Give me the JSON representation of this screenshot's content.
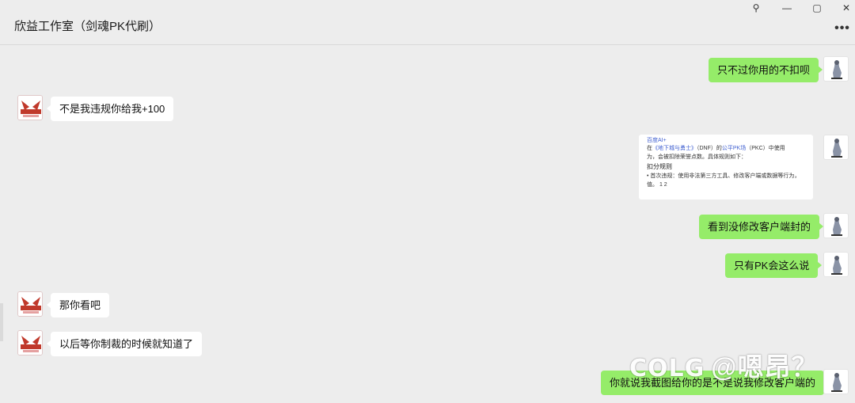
{
  "window": {
    "title": "欣益工作室（剑魂PK代刷）",
    "controls": {
      "pin": "⚲",
      "minimize": "—",
      "maximize": "▢",
      "close": "✕"
    },
    "more": "•••"
  },
  "messages": [
    {
      "side": "right",
      "text": "只不过你用的不扣呗"
    },
    {
      "side": "left",
      "text": "不是我违规你给我+100"
    },
    {
      "side": "right",
      "type": "image",
      "image": {
        "header": "百度AI+",
        "line1_prefix": "在",
        "line1_link1": "《地下城与勇士》",
        "line1_mid": "（DNF）的",
        "line1_link2": "公平PK场",
        "line1_suffix": "（PKC）中使用",
        "line2": "为，会被扣除荣誉点数。具体规则如下：",
        "subheading": "扣分规则",
        "bullet": "• 首次违规：使用非法第三方工具、修改客户端或数据等行为，",
        "line4": "值。 1 2"
      }
    },
    {
      "side": "right",
      "text": "看到没修改客户端封的"
    },
    {
      "side": "right",
      "text": "只有PK会这么说"
    },
    {
      "side": "left",
      "text": "那你看吧"
    },
    {
      "side": "left",
      "text": "以后等你制裁的时候就知道了"
    },
    {
      "side": "right",
      "text": "你就说我截图给你的是不是说我修改客户端的"
    }
  ],
  "watermark": {
    "logo": "COLG",
    "handle": "@嗯昂？"
  },
  "colors": {
    "self_bubble": "#95ec69",
    "peer_bubble": "#ffffff",
    "background": "#ededed"
  }
}
